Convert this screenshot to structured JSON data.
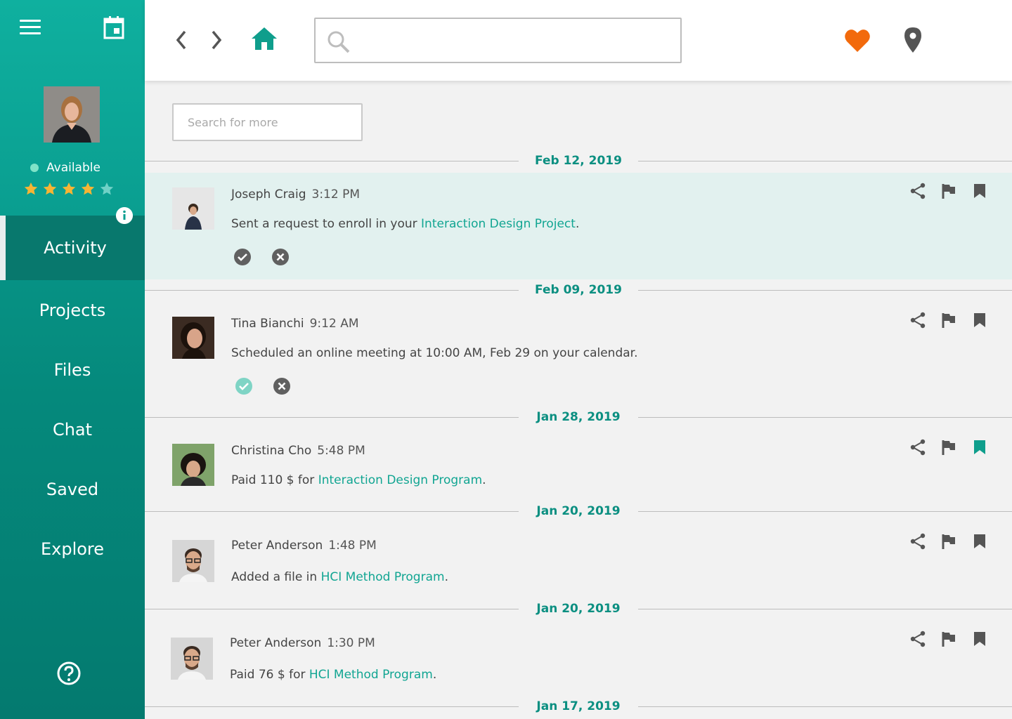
{
  "sidebar": {
    "status_text": "Available",
    "rating": 4,
    "rating_max": 5,
    "nav": [
      {
        "label": "Activity",
        "active": true
      },
      {
        "label": "Projects",
        "active": false
      },
      {
        "label": "Files",
        "active": false
      },
      {
        "label": "Chat",
        "active": false
      },
      {
        "label": "Saved",
        "active": false
      },
      {
        "label": "Explore",
        "active": false
      }
    ]
  },
  "topbar": {
    "search_placeholder": "",
    "icons": [
      "chevron-left-icon",
      "chevron-right-icon",
      "home-icon",
      "search-icon",
      "heart-icon",
      "location-pin-icon"
    ]
  },
  "content": {
    "search_more_placeholder": "Search for more",
    "dates": [
      "Feb 12, 2019",
      "Feb 09, 2019",
      "Jan 28, 2019",
      "Jan 20, 2019",
      "Jan 20, 2019",
      "Jan 17, 2019"
    ],
    "items": [
      {
        "name": "Joseph Craig",
        "time": "3:12 PM",
        "msg_pre": "Sent a request to enroll in your ",
        "msg_link": "Interaction Design Project",
        "msg_post": ".",
        "has_response": true,
        "accepted": false,
        "saved": false,
        "highlighted": true
      },
      {
        "name": "Tina Bianchi",
        "time": "9:12 AM",
        "msg_pre": "Scheduled an online meeting at 10:00 AM, Feb 29 on your calendar.",
        "msg_link": "",
        "msg_post": "",
        "has_response": true,
        "accepted": true,
        "saved": false,
        "highlighted": false
      },
      {
        "name": "Christina Cho",
        "time": "5:48 PM",
        "msg_pre": "Paid 110 $ for ",
        "msg_link": "Interaction Design Program",
        "msg_post": ".",
        "has_response": false,
        "saved": true,
        "highlighted": false
      },
      {
        "name": "Peter Anderson",
        "time": "1:48 PM",
        "msg_pre": "Added a file in ",
        "msg_link": "HCI Method Program",
        "msg_post": ".",
        "has_response": false,
        "saved": false,
        "highlighted": false
      },
      {
        "name": "Peter Anderson",
        "time": "1:30 PM",
        "msg_pre": "Paid 76 $ for ",
        "msg_link": "HCI Method Program",
        "msg_post": ".",
        "has_response": false,
        "saved": false,
        "highlighted": false
      }
    ]
  },
  "colors": {
    "accent": "#0aa697",
    "link": "#11a592",
    "heart": "#f26a0c",
    "saved": "#0f9e8c",
    "highlight_row": "#e2f1ef"
  }
}
